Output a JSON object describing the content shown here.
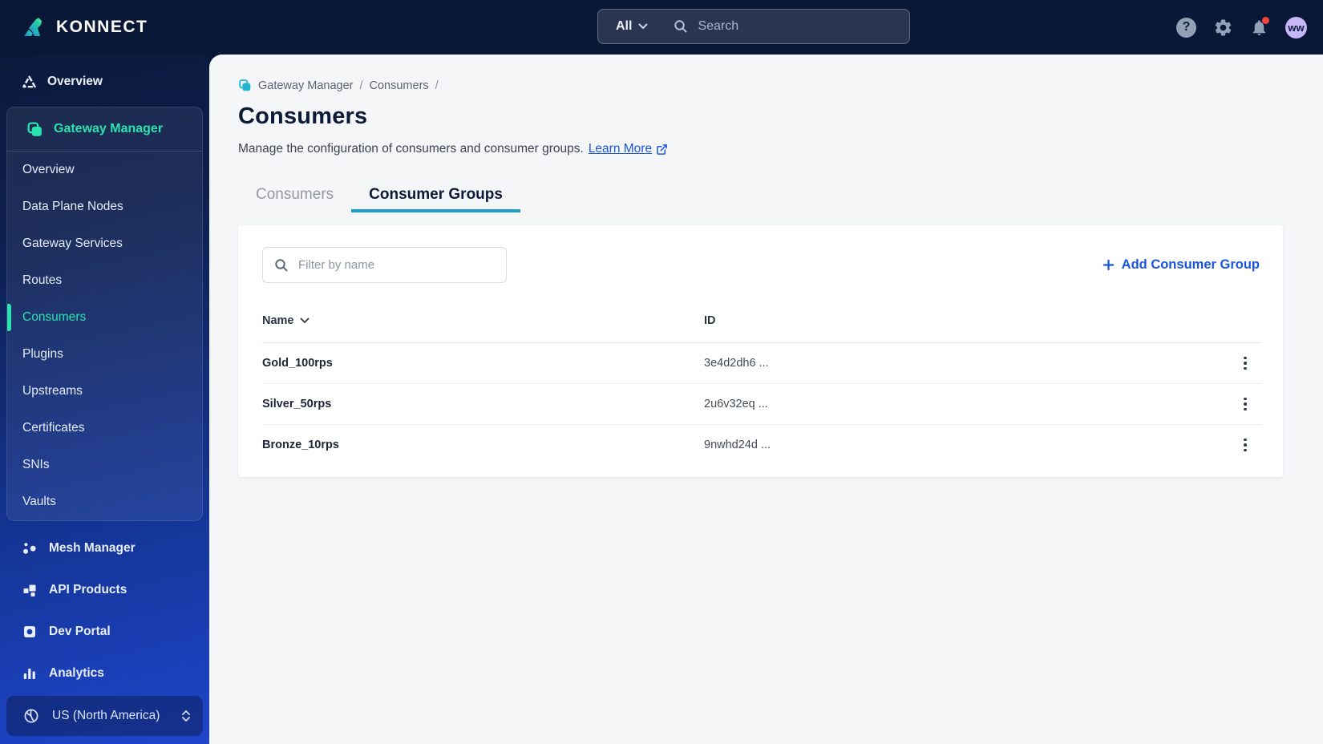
{
  "topbar": {
    "logo_text": "KONNECT",
    "search_scope": "All",
    "search_placeholder": "Search",
    "help_glyph": "?",
    "avatar_initials": "ww"
  },
  "sidebar": {
    "overview": "Overview",
    "gateway_manager_label": "Gateway Manager",
    "gateway_items": [
      "Overview",
      "Data Plane Nodes",
      "Gateway Services",
      "Routes",
      "Consumers",
      "Plugins",
      "Upstreams",
      "Certificates",
      "SNIs",
      "Vaults"
    ],
    "selected_item": "Consumers",
    "bottom_items": [
      "Mesh Manager",
      "API Products",
      "Dev Portal",
      "Analytics"
    ],
    "region": "US (North America)"
  },
  "page": {
    "breadcrumb_root": "Gateway Manager",
    "breadcrumb_sep1": "/",
    "breadcrumb_current": "Consumers",
    "breadcrumb_sep2": "/",
    "title": "Consumers",
    "description": "Manage the configuration of consumers and consumer groups.",
    "learn_more_label": "Learn More",
    "tabs": [
      {
        "label": "Consumers"
      },
      {
        "label": "Consumer Groups"
      }
    ],
    "active_tab": "Consumer Groups",
    "filter_placeholder": "Filter by name",
    "add_button_label": "Add Consumer Group",
    "table": {
      "col_name": "Name",
      "col_id": "ID",
      "rows": [
        {
          "name": "Gold_100rps",
          "id": "3e4d2dh6 ..."
        },
        {
          "name": "Silver_50rps",
          "id": "2u6v32eq ..."
        },
        {
          "name": "Bronze_10rps",
          "id": "9nwhd24d ..."
        }
      ]
    }
  },
  "colors": {
    "accent_teal": "#2be3ae",
    "breadcrumb_icon": "#1fb6d2",
    "tab_underline": "#189fc9",
    "link_blue": "#1b55d9",
    "notification_red": "#f2453d",
    "avatar_bg": "#c9b6f6"
  }
}
